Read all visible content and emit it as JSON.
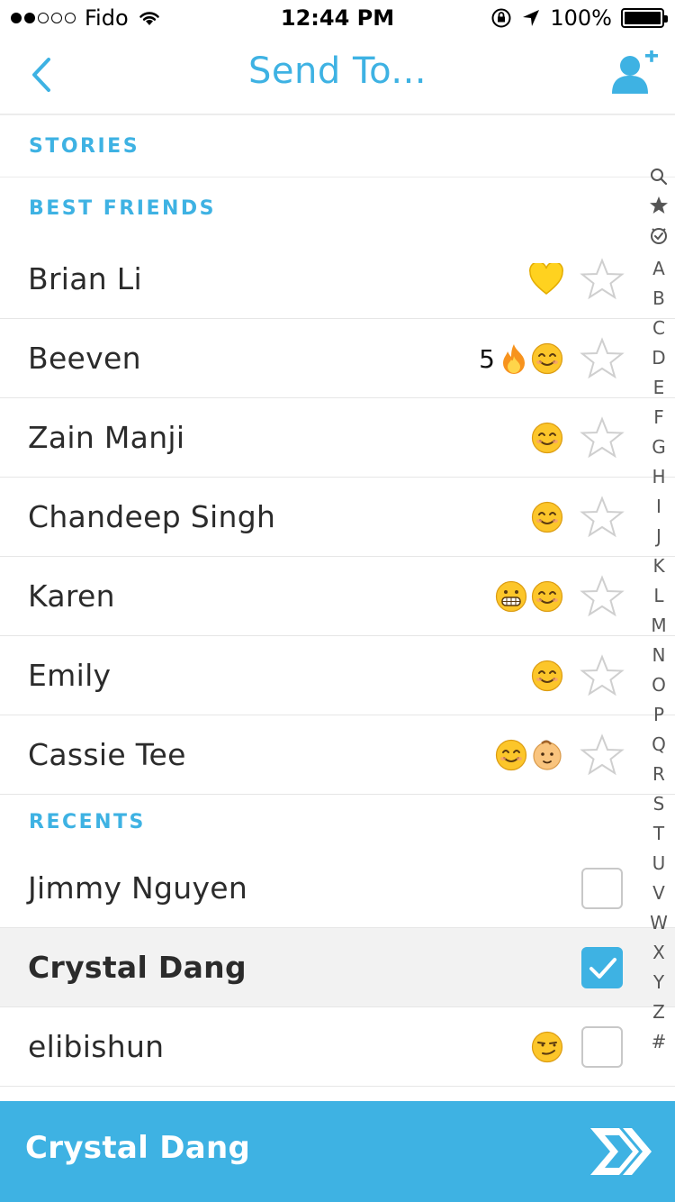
{
  "status_bar": {
    "carrier": "Fido",
    "time": "12:44 PM",
    "battery": "100%"
  },
  "nav": {
    "title": "Send To...",
    "back_icon": "chevron-left-icon",
    "add_friend_icon": "add-friend-icon"
  },
  "sections": {
    "stories": "STORIES",
    "best_friends": "BEST FRIENDS",
    "recents": "RECENTS"
  },
  "best_friends": [
    {
      "name": "Brian Li",
      "emojis": [
        "yellow-heart"
      ]
    },
    {
      "name": "Beeven",
      "streak": "5",
      "emojis": [
        "fire",
        "smile"
      ]
    },
    {
      "name": "Zain Manji",
      "emojis": [
        "smile"
      ]
    },
    {
      "name": "Chandeep Singh",
      "emojis": [
        "smile"
      ]
    },
    {
      "name": "Karen",
      "emojis": [
        "grimace",
        "smile"
      ]
    },
    {
      "name": "Emily",
      "emojis": [
        "smile"
      ]
    },
    {
      "name": "Cassie Tee",
      "emojis": [
        "smile",
        "baby"
      ]
    }
  ],
  "recents": [
    {
      "name": "Jimmy Nguyen",
      "checked": false
    },
    {
      "name": "Crystal Dang",
      "checked": true
    },
    {
      "name": "elibishun",
      "checked": false,
      "emojis": [
        "smirk"
      ]
    }
  ],
  "alphabet": [
    "Q",
    "★",
    "◷",
    "A",
    "B",
    "C",
    "D",
    "E",
    "F",
    "G",
    "H",
    "I",
    "J",
    "K",
    "L",
    "M",
    "N",
    "O",
    "P",
    "Q",
    "R",
    "S",
    "T",
    "U",
    "V",
    "W",
    "X",
    "Y",
    "Z",
    "#"
  ],
  "send_bar": {
    "recipients": "Crystal Dang",
    "send_icon": "double-chevron-right-icon"
  },
  "colors": {
    "accent": "#3eb2e3",
    "selected_row": "#f2f2f2"
  }
}
